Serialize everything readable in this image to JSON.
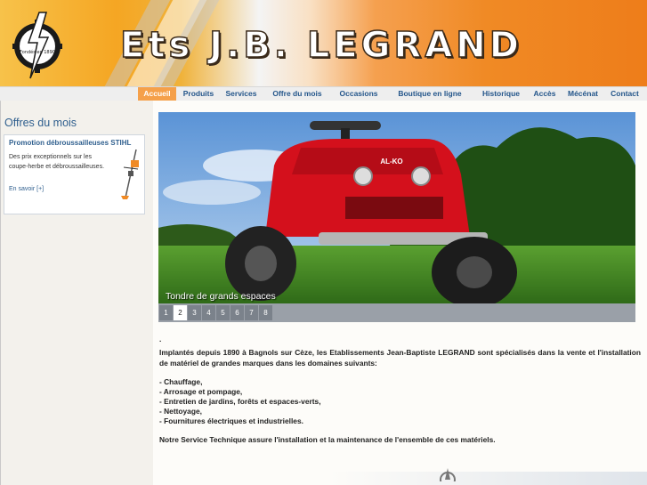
{
  "header": {
    "title": "Ets J.B. LEGRAND",
    "logo_text": "Fondés en 1890"
  },
  "nav": {
    "items": [
      {
        "label": "Accueil",
        "active": true
      },
      {
        "label": "Produits"
      },
      {
        "label": "Services"
      },
      {
        "label": "Offre du mois"
      },
      {
        "label": "Occasions"
      },
      {
        "label": "Boutique en ligne"
      },
      {
        "label": "Historique"
      },
      {
        "label": "Accès"
      },
      {
        "label": "Mécénat"
      },
      {
        "label": "Contact"
      }
    ]
  },
  "sidebar": {
    "heading": "Offres du mois",
    "promo": {
      "title": "Promotion débroussailleuses STIHL",
      "text": "Des prix exceptionnels sur les coupe-herbe et débroussailleuses.",
      "link": "En savoir [+]"
    }
  },
  "slider": {
    "caption": "Tondre de grands espaces",
    "pages": [
      "1",
      "2",
      "3",
      "4",
      "5",
      "6",
      "7",
      "8"
    ],
    "active_page": "2",
    "brand_on_mower": "AL-KO"
  },
  "content": {
    "dot": ".",
    "intro": "Implantés depuis 1890 à Bagnols sur Cèze, les Etablissements Jean-Baptiste LEGRAND sont spécialisés dans la vente et l'installation de matériel de grandes marques dans les domaines suivants:",
    "list": [
      "- Chauffage,",
      "- Arrosage et pompage,",
      "- Entretien de jardins, forêts et espaces-verts,",
      "- Nettoyage,",
      "- Fournitures électriques et industrielles."
    ],
    "footer_note": "Notre Service Technique assure l'installation et la maintenance de l'ensemble de ces matériels."
  },
  "colors": {
    "nav_active": "#f5a04a",
    "nav_text": "#23558a",
    "heading_blue": "#2f5f8e",
    "header_orange": "#ee7d1a",
    "mower_red": "#d4101c"
  }
}
